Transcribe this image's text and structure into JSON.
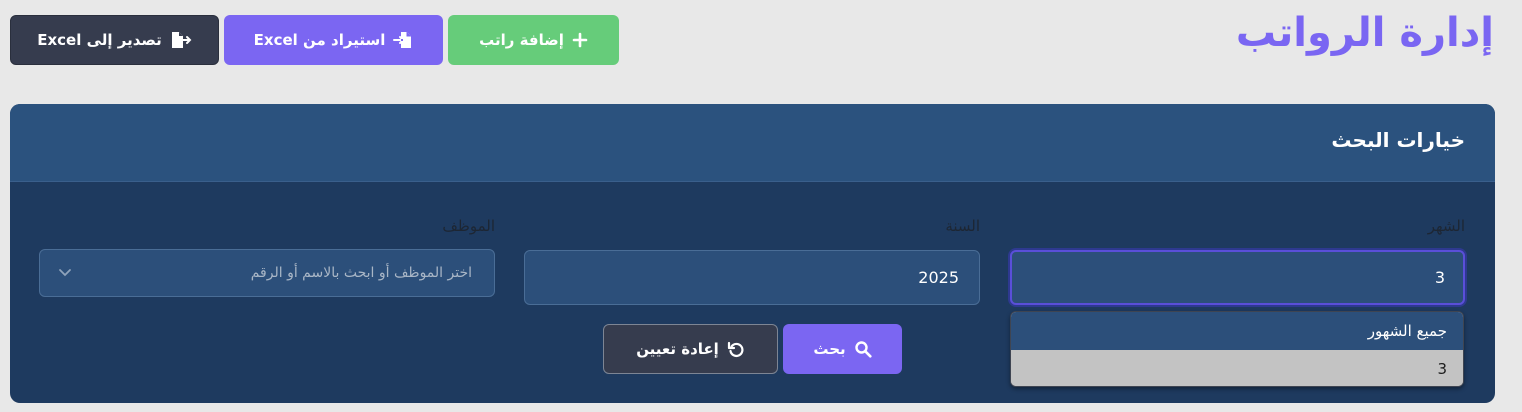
{
  "header": {
    "title": "إدارة الرواتب",
    "buttons": {
      "add": "إضافة راتب",
      "import": "استيراد من Excel",
      "export": "تصدير إلى Excel"
    }
  },
  "search_panel": {
    "title": "خيارات البحث",
    "month": {
      "label": "الشهر",
      "value": "3",
      "options": [
        "جميع الشهور",
        "3"
      ],
      "highlighted_option": "جميع الشهور"
    },
    "year": {
      "label": "السنة",
      "value": "2025"
    },
    "employee": {
      "label": "الموظف",
      "placeholder": "اختر الموظف أو ابحث بالاسم أو الرقم"
    },
    "buttons": {
      "search": "بحث",
      "reset": "إعادة تعيين"
    }
  },
  "colors": {
    "accent": "#7b66f2",
    "success": "#66cc7a",
    "dark": "#363c4e",
    "panel": "#1e3a5f",
    "panel_header": "#2b527e"
  },
  "icons": {
    "add": "plus-icon",
    "import": "file-import-icon",
    "export": "file-export-icon",
    "search": "search-icon",
    "reset": "undo-icon",
    "select": "chevron-down-icon"
  }
}
